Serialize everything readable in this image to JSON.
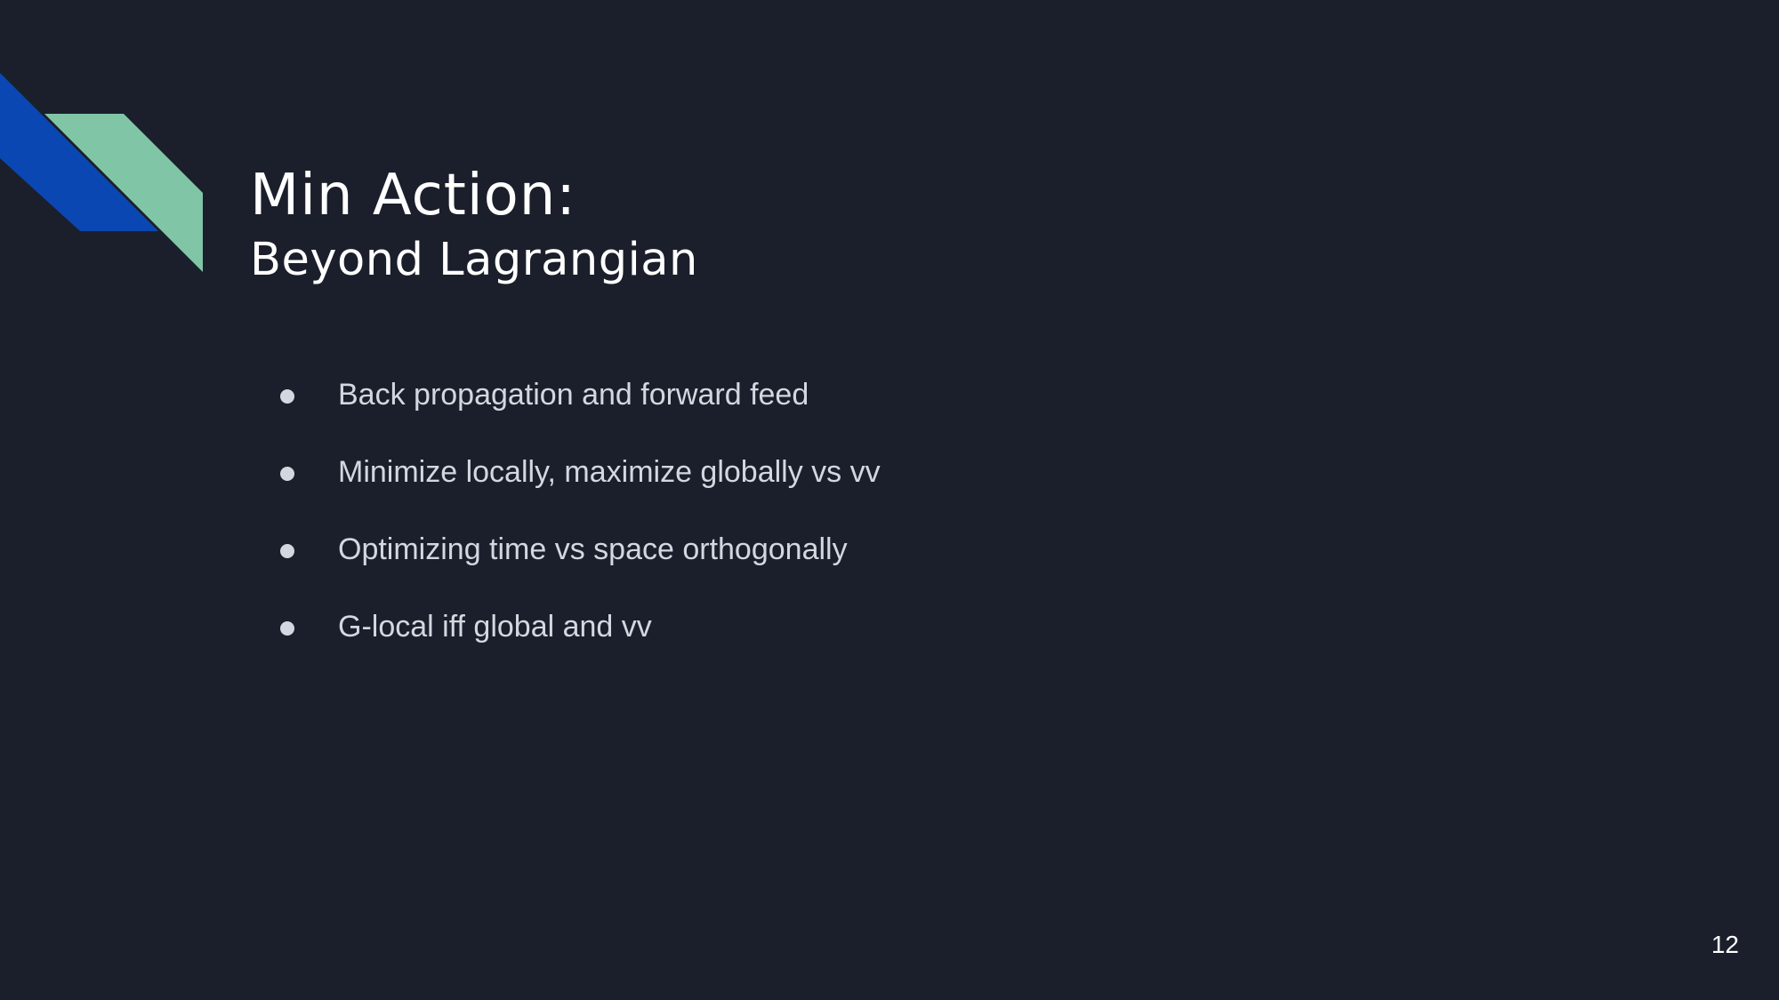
{
  "slide": {
    "title": "Min Action:",
    "subtitle": "Beyond Lagrangian",
    "bullets": [
      "Back propagation and forward feed",
      "Minimize locally, maximize globally vs vv",
      "Optimizing time vs space orthogonally",
      "G-local iff global and vv"
    ],
    "page_number": "12"
  },
  "colors": {
    "background": "#1b1f2b",
    "accent_blue": "#0b47b3",
    "accent_green": "#80c6a6",
    "text": "#ffffff",
    "bullet_text": "#d3d7df"
  }
}
